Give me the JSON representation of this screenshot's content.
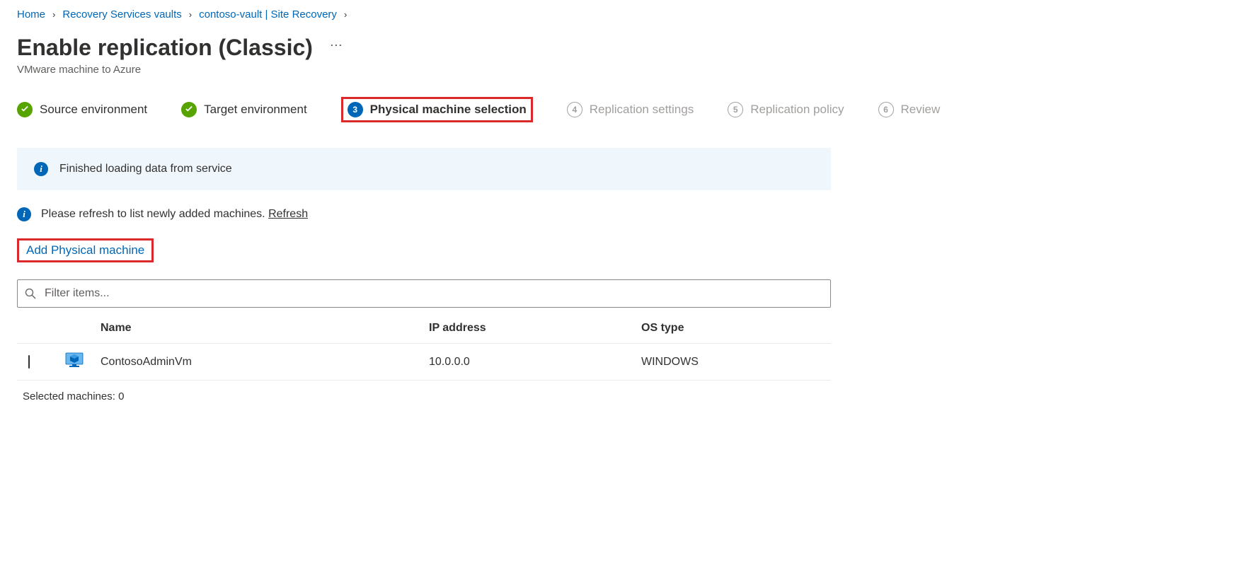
{
  "breadcrumb": [
    {
      "label": "Home"
    },
    {
      "label": "Recovery Services vaults"
    },
    {
      "label": "contoso-vault | Site Recovery"
    }
  ],
  "header": {
    "title": "Enable replication (Classic)",
    "subtitle": "VMware machine to Azure"
  },
  "steps": [
    {
      "label": "Source environment",
      "state": "done"
    },
    {
      "label": "Target environment",
      "state": "done"
    },
    {
      "label": "Physical machine selection",
      "state": "active",
      "num": "3",
      "highlight": true
    },
    {
      "label": "Replication settings",
      "state": "pending",
      "num": "4"
    },
    {
      "label": "Replication policy",
      "state": "pending",
      "num": "5"
    },
    {
      "label": "Review",
      "state": "pending",
      "num": "6"
    }
  ],
  "banner": {
    "text": "Finished loading data from service"
  },
  "hint": {
    "text": "Please refresh to list newly added machines. ",
    "link": "Refresh"
  },
  "add_link": "Add Physical machine",
  "filter": {
    "placeholder": "Filter items..."
  },
  "table": {
    "headers": {
      "name": "Name",
      "ip": "IP address",
      "os": "OS type"
    },
    "rows": [
      {
        "name": "ContosoAdminVm",
        "ip": "10.0.0.0",
        "os": "WINDOWS"
      }
    ]
  },
  "selected": {
    "label": "Selected machines: ",
    "count": "0"
  }
}
